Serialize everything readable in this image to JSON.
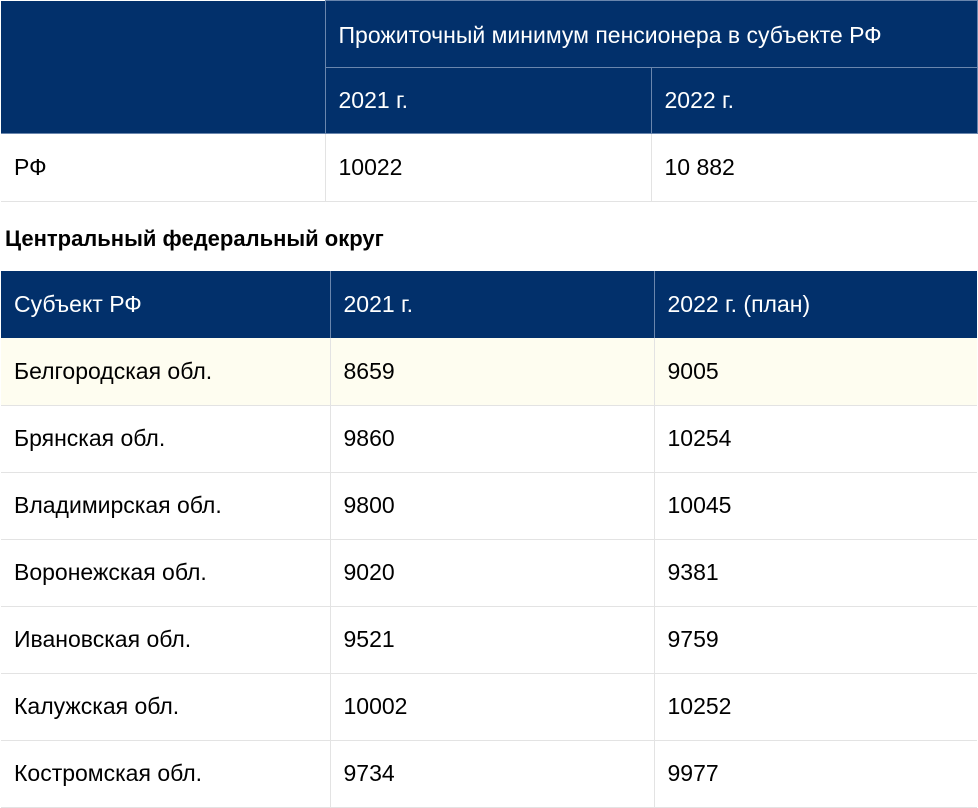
{
  "summary_table": {
    "title": "Прожиточный минимум пенсионера в субъекте РФ",
    "col_2021": "2021 г.",
    "col_2022": "2022 г.",
    "row": {
      "region": "РФ",
      "v2021": "10022",
      "v2022": "10 882"
    }
  },
  "district": {
    "title": "Центральный федеральный округ",
    "headers": [
      "Субъект РФ",
      "2021 г.",
      "2022 г. (план)"
    ],
    "rows": [
      {
        "region": "Белгородская обл.",
        "v2021": "8659",
        "v2022": "9005"
      },
      {
        "region": "Брянская обл.",
        "v2021": "9860",
        "v2022": "10254"
      },
      {
        "region": "Владимирская обл.",
        "v2021": "9800",
        "v2022": "10045"
      },
      {
        "region": "Воронежская обл.",
        "v2021": "9020",
        "v2022": "9381"
      },
      {
        "region": "Ивановская обл.",
        "v2021": "9521",
        "v2022": "9759"
      },
      {
        "region": "Калужская обл.",
        "v2021": "10002",
        "v2022": "10252"
      },
      {
        "region": "Костромская обл.",
        "v2021": "9734",
        "v2022": "9977"
      }
    ]
  },
  "colors": {
    "header_bg": "#02306b",
    "header_text": "#ffffff",
    "highlight_row": "#fefdf0",
    "grid_line": "#e3e3e3"
  }
}
